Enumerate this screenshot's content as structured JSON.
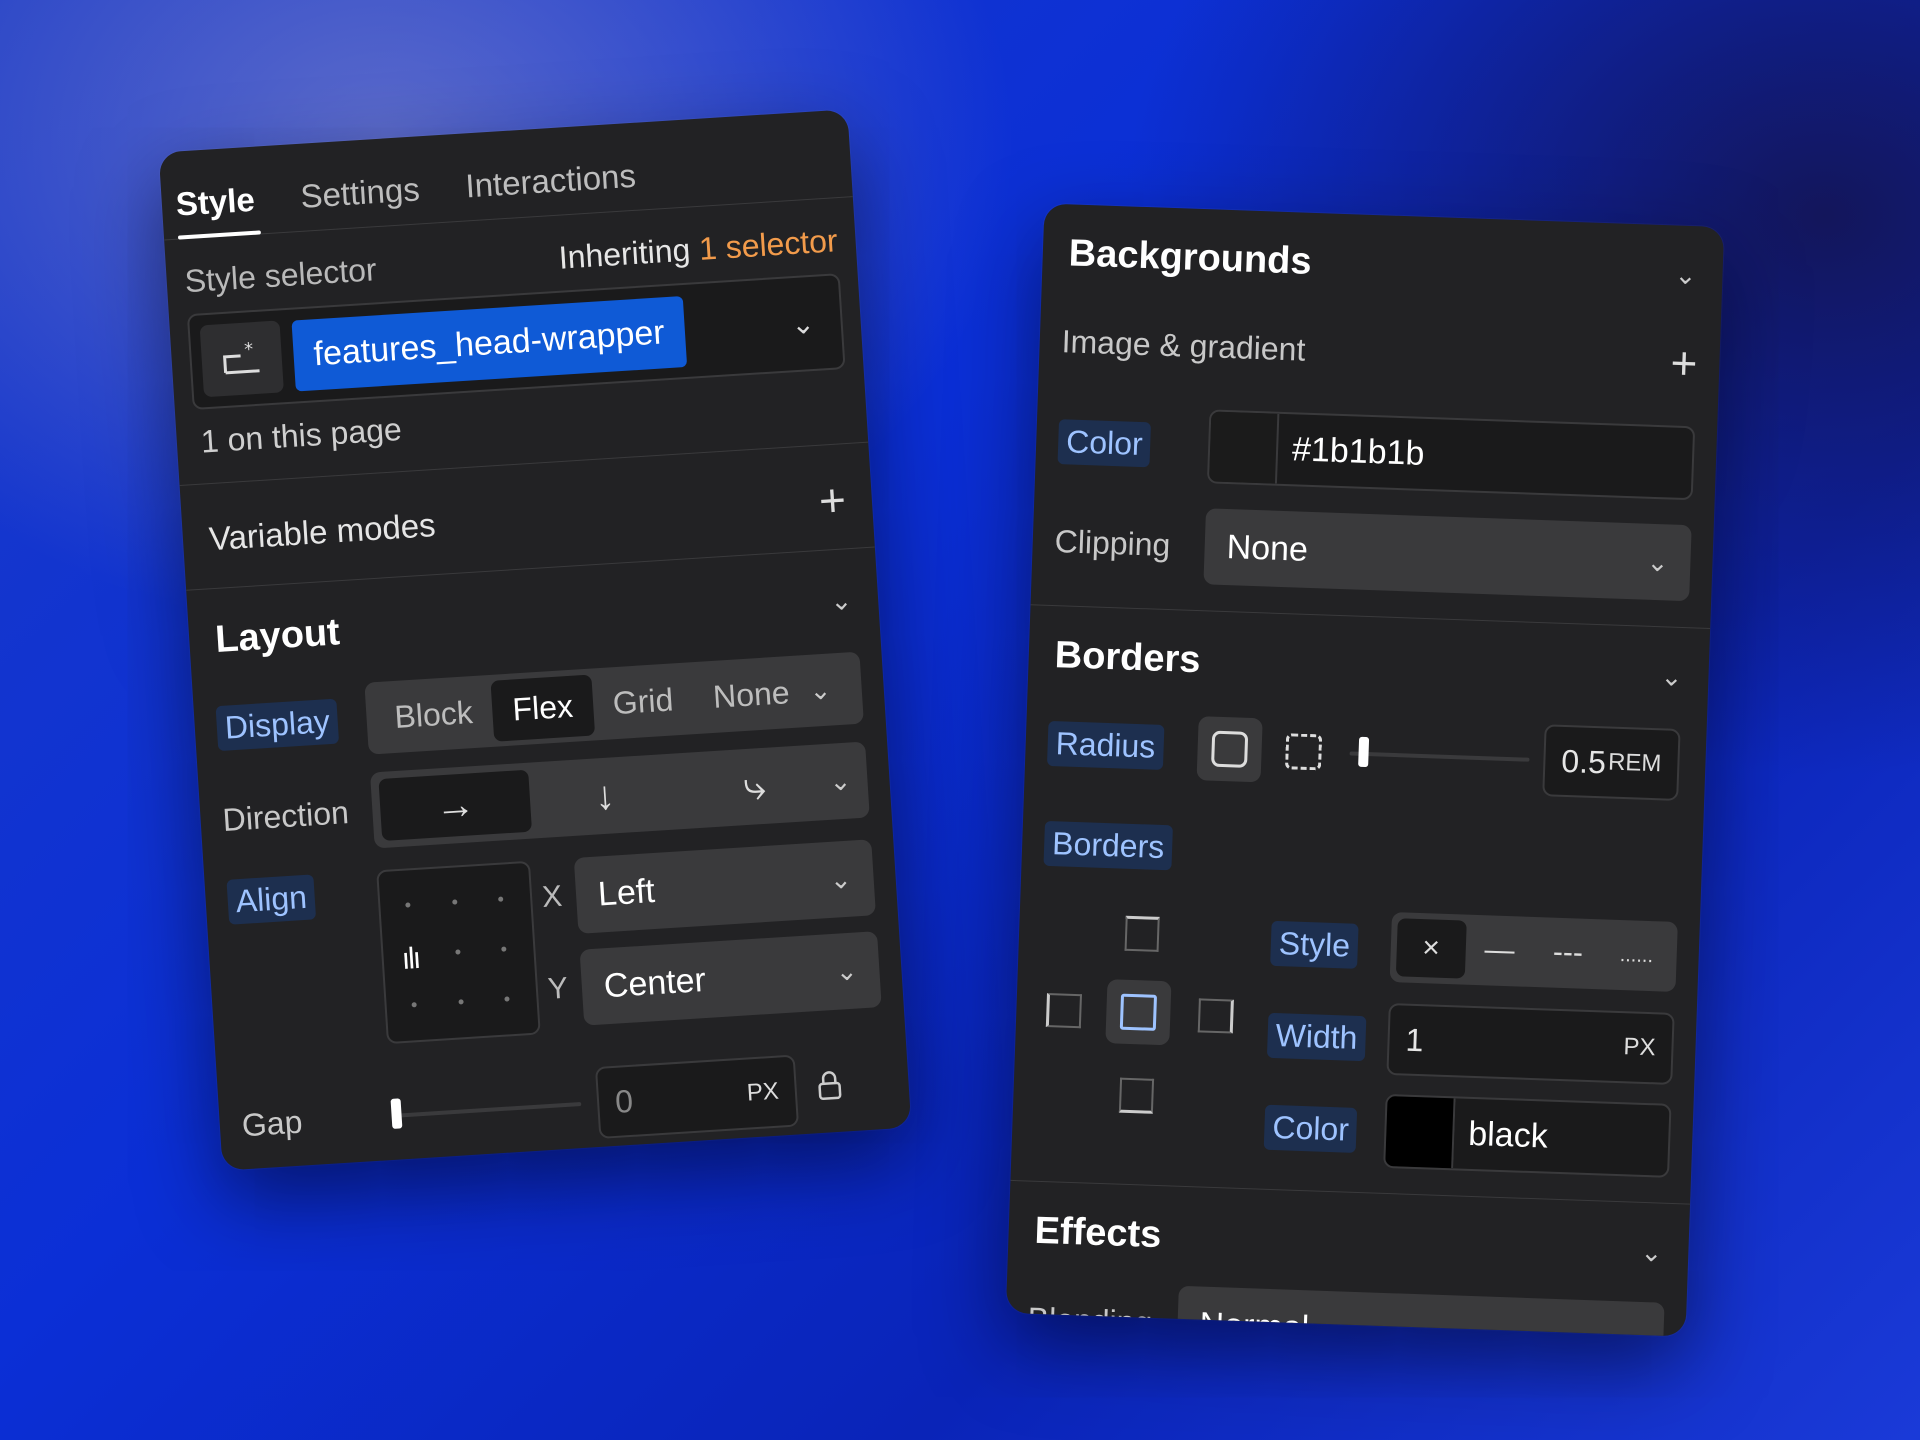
{
  "left_panel": {
    "tabs": [
      "Style",
      "Settings",
      "Interactions"
    ],
    "active_tab": "Style",
    "style_selector": {
      "label": "Style selector",
      "inheriting_prefix": "Inheriting",
      "inheriting_count": "1 selector",
      "icon": "selector-icon",
      "selected": "features_head-wrapper",
      "on_page": "1 on this page"
    },
    "variable_modes": {
      "label": "Variable modes"
    },
    "layout": {
      "title": "Layout",
      "display": {
        "label": "Display",
        "options": [
          "Block",
          "Flex",
          "Grid",
          "None"
        ],
        "selected": "Flex"
      },
      "direction": {
        "label": "Direction",
        "options": [
          "→",
          "↓",
          "Z"
        ]
      },
      "align": {
        "label": "Align",
        "x_axis": "X",
        "x_value": "Left",
        "y_axis": "Y",
        "y_value": "Center"
      },
      "gap": {
        "label": "Gap",
        "value": "0",
        "unit": "PX",
        "slider_value": 0
      }
    }
  },
  "right_panel": {
    "backgrounds": {
      "title": "Backgrounds",
      "image_gradient": "Image & gradient",
      "color_label": "Color",
      "color_value": "#1b1b1b",
      "clipping_label": "Clipping",
      "clipping_value": "None"
    },
    "borders": {
      "title": "Borders",
      "radius_label": "Radius",
      "radius_value": "0.5",
      "radius_unit": "REM",
      "radius_slider": 0.05,
      "borders_label": "Borders",
      "style_label": "Style",
      "style_options": [
        "×",
        "—",
        "---",
        "......"
      ],
      "width_label": "Width",
      "width_value": "1",
      "width_unit": "PX",
      "color_label": "Color",
      "color_value": "black",
      "color_swatch": "#000000"
    },
    "effects": {
      "title": "Effects",
      "blending_label": "Blending",
      "blending_value": "Normal"
    }
  },
  "colors": {
    "accent_blue": "#0f5ad6",
    "accent_orange": "#f29b4b",
    "panel_bg": "#222224",
    "label_chip": "#9ec3ff"
  }
}
